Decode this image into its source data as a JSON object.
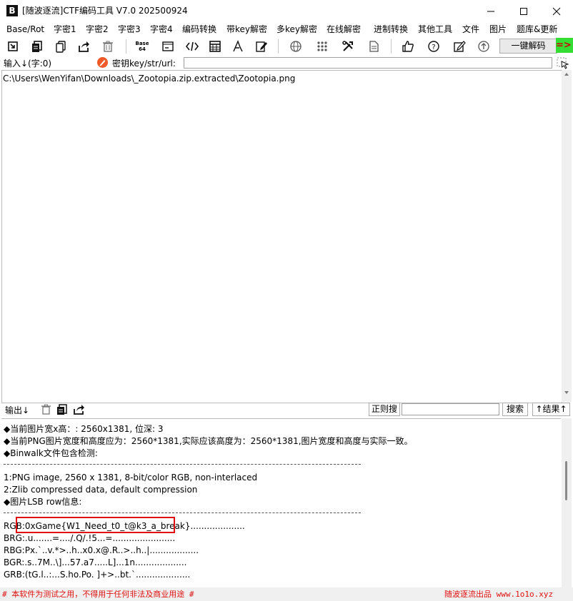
{
  "window": {
    "title": "[随波逐流]CTF编码工具 V7.0  202500924",
    "logo_text": "B",
    "controls": [
      "minimize",
      "maximize",
      "close"
    ]
  },
  "menu": [
    "Base/Rot",
    "字密1",
    "字密2",
    "字密3",
    "字密4",
    "编码转换",
    "带key解密",
    "多key解密",
    "在线解密",
    "进制转换",
    "其他工具",
    "文件",
    "图片",
    "题库&更新"
  ],
  "toolbar": {
    "icons": [
      "import-icon",
      "copy-icon",
      "paste-icon",
      "share-icon",
      "trash-icon",
      "base-icon",
      "terminal-icon",
      "code-icon",
      "calculator-icon",
      "font-icon",
      "edit-doc-icon",
      "globe-icon",
      "grid-icon",
      "tools-icon",
      "document-icon",
      "thumbs-up-icon",
      "help-icon",
      "pencil-icon",
      "upload-icon"
    ],
    "base_label_top": "Base",
    "base_label_bottom": "64",
    "decode_label": "一键解码",
    "decode_arrow": "=>"
  },
  "input": {
    "label": "输入↓(字:0)",
    "key_label": "密钥key/str/url:",
    "key_value": "",
    "content": "C:\\Users\\WenYifan\\Downloads\\_Zootopia.zip.extracted\\Zootopia.png"
  },
  "output": {
    "label": "输出↓",
    "regex_search_label": "正则搜",
    "search_value": "",
    "search_label": "搜索",
    "result_label": "↑结果↑",
    "lines": [
      {
        "kind": "text",
        "text": "◆当前图片宽x高：: 2560x1381, 位深: 3"
      },
      {
        "kind": "text",
        "text": "◆当前PNG图片宽度和高度应为：2560*1381,实际应该高度为：2560*1381,图片宽度和高度与实际一致。"
      },
      {
        "kind": "text",
        "text": "◆Binwalk文件包含检测:"
      },
      {
        "kind": "text",
        "text": "1:PNG image, 2560 x 1381, 8-bit/color RGB, non-interlaced"
      },
      {
        "kind": "text",
        "text": "2:Zlib compressed data, default compression"
      },
      {
        "kind": "text",
        "text": "◆图片LSB row信息:"
      },
      {
        "kind": "text",
        "text": "RGB:0xGame{W1_Need_t0_t@k3_a_break}...................."
      },
      {
        "kind": "text",
        "text": "BRG:.u.......=..../.Q/.!5...=......................."
      },
      {
        "kind": "text",
        "text": "RBG:Px.`..v.*>..h..x0.x@.R..>..h..|.................."
      },
      {
        "kind": "text",
        "text": "BGR:.s..7M..\\]...57.a7.....L]...1n..................."
      },
      {
        "kind": "text",
        "text": "GRB:(tG.l..:...S.ho.Po. ]+>..bt.`...................."
      }
    ]
  },
  "footer": {
    "left": "# 本软件为测试之用，不得用于任何非法及商业用途 #",
    "right": "随波逐流出品 www.1o1o.xyz"
  },
  "colors": {
    "accent_red": "#e01010",
    "arrow_green": "#33dd33"
  }
}
